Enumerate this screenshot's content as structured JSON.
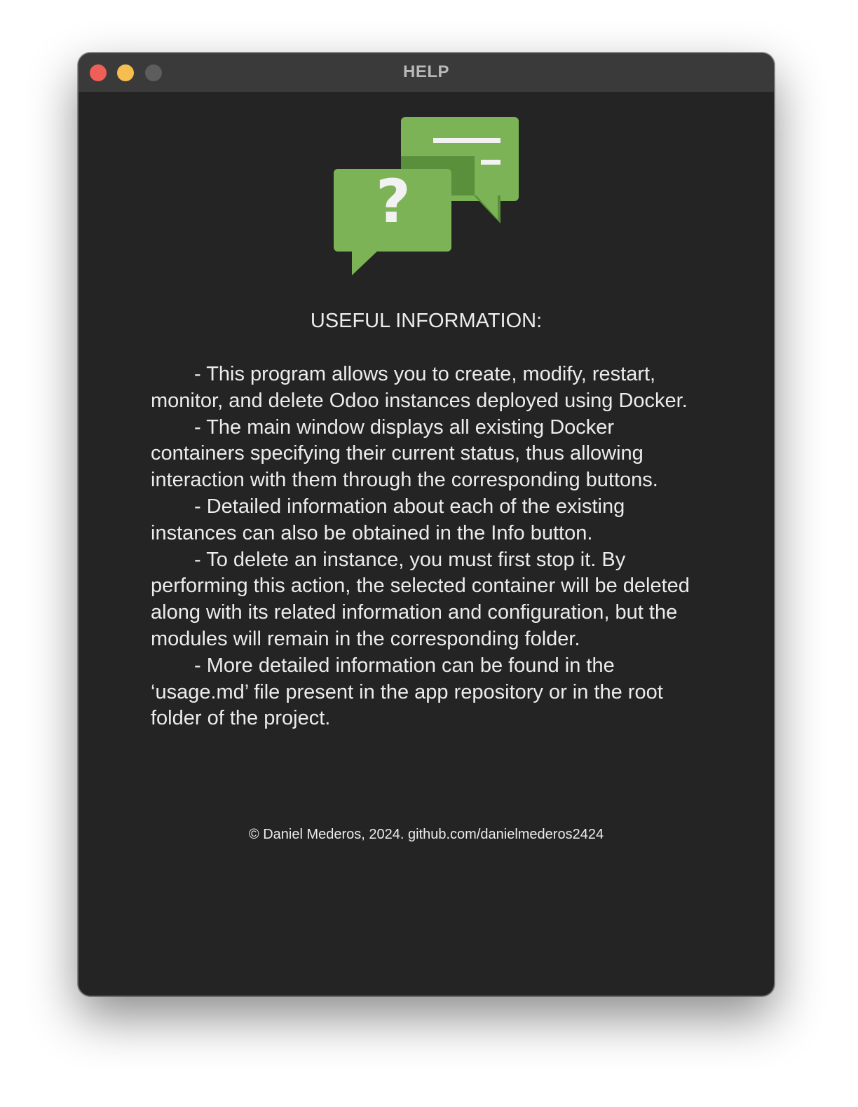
{
  "window": {
    "title": "HELP",
    "controls": [
      "close-icon",
      "minimize-icon",
      "zoom-icon"
    ]
  },
  "illustration": {
    "icon": "help-chat-bubbles-icon",
    "color": "#7cb356",
    "dark_color": "#5a8f3b",
    "symbol": "?"
  },
  "content": {
    "heading": "USEFUL INFORMATION:",
    "items": [
      "- This program allows you to create, modify, restart, monitor, and delete Odoo instances deployed using Docker.",
      "- The main window displays all existing Docker containers specifying their current status, thus allowing interaction with them through the corresponding buttons.",
      "- Detailed information about each of the existing instances can also be obtained in the Info button.",
      "- To delete an instance, you must first stop it. By performing this action, the selected container will be deleted along with its related information and configuration, but the modules will remain in the corresponding folder.",
      "- More detailed information can be found in the ‘usage.md’ file present in the app repository or in the root folder of the project."
    ],
    "footer": "© Daniel Mederos, 2024. github.com/danielmederos2424"
  }
}
